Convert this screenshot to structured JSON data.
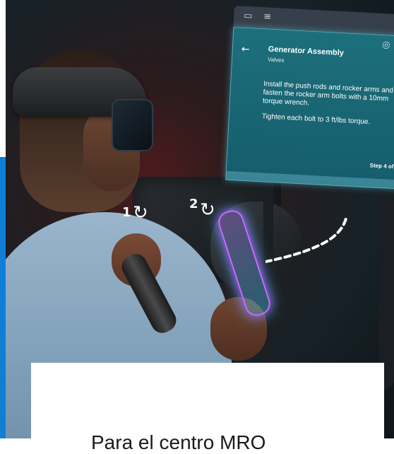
{
  "hologram": {
    "title": "Generator Assembly",
    "subtitle": "Valves",
    "instruction": "Install the push rods and rocker arms and fasten the rocker arm bolts with a 10mm torque wrench.",
    "instruction2": "Tighten each bolt to 3 ft/lbs torque.",
    "step": "Step 4 of"
  },
  "annotations": {
    "step1": "1",
    "step2": "2"
  },
  "card": {
    "title": "Para el centro MRO"
  },
  "colors": {
    "accent": "#0f7fd6",
    "hologram_panel": "#1d6f7c",
    "holo_wrench": "#c86cff"
  }
}
